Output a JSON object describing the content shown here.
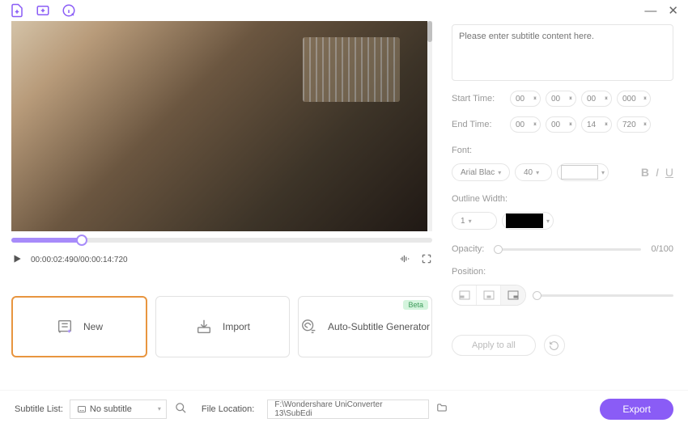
{
  "playback": {
    "current_time": "00:00:02:490",
    "total_time": "00:00:14:720"
  },
  "cards": {
    "new": "New",
    "import": "Import",
    "auto": "Auto-Subtitle Generator",
    "beta": "Beta"
  },
  "subtitle": {
    "placeholder": "Please enter subtitle content here."
  },
  "start_time": {
    "label": "Start Time:",
    "h": "00",
    "m": "00",
    "s": "00",
    "ms": "000"
  },
  "end_time": {
    "label": "End Time:",
    "h": "00",
    "m": "00",
    "s": "14",
    "ms": "720"
  },
  "font": {
    "label": "Font:",
    "family": "Arial Blac",
    "size": "40"
  },
  "outline": {
    "label": "Outline Width:",
    "width": "1"
  },
  "opacity": {
    "label": "Opacity:",
    "value": "0/100"
  },
  "position": {
    "label": "Position:"
  },
  "apply_all": "Apply to all",
  "footer": {
    "subtitle_list_label": "Subtitle List:",
    "subtitle_list_value": "No subtitle",
    "file_location_label": "File Location:",
    "file_location_value": "F:\\Wondershare UniConverter 13\\SubEdi",
    "export": "Export"
  }
}
